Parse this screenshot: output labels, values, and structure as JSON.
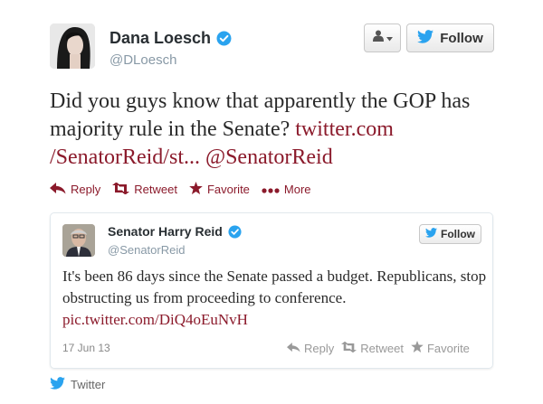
{
  "tweet": {
    "author_name": "Dana Loesch",
    "author_handle": "@DLoesch",
    "follow_label": "Follow",
    "text_plain": "Did you guys know that apparently the GOP has majority rule in the Senate? ",
    "link_text": "twitter.com /SenatorReid/st...",
    "mention": "@SenatorReid",
    "actions": {
      "reply": "Reply",
      "retweet": "Retweet",
      "favorite": "Favorite",
      "more": "More"
    },
    "accent_color": "#8b1a2b"
  },
  "quoted": {
    "author_name": "Senator Harry Reid",
    "author_handle": "@SenatorReid",
    "follow_label": "Follow",
    "text_plain": "It's been 86 days since the Senate passed a budget. Republicans, stop obstructing us from proceeding to conference. ",
    "link_text": "pic.twitter.com/DiQ4oEuNvH",
    "date": "17 Jun 13",
    "actions": {
      "reply": "Reply",
      "retweet": "Retweet",
      "favorite": "Favorite"
    }
  },
  "footer": {
    "label": "Twitter"
  },
  "icons": {
    "verified": "verified-badge-icon",
    "twitter_bird": "twitter-bird-icon",
    "person": "person-icon",
    "reply": "reply-arrow-icon",
    "retweet": "retweet-icon",
    "favorite": "star-icon",
    "more": "dots-icon"
  }
}
